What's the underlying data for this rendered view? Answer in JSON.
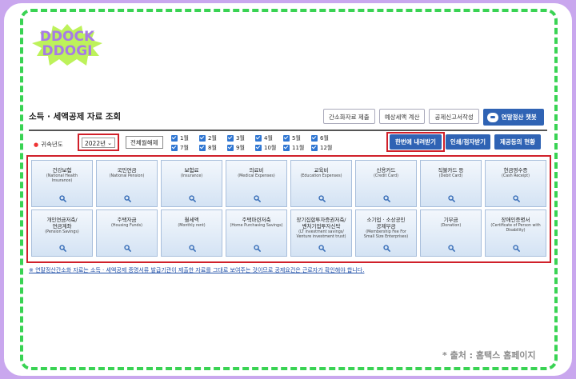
{
  "logo": {
    "line1": "DDOCK",
    "line2": "DDOGI"
  },
  "page_title": "소득 · 세액공제 자료 조회",
  "top_buttons": {
    "simplified": "간소화자료 제출",
    "estimate": "예상세액 계산",
    "deduction_form": "공제신고서작성",
    "chatbot": "연말정산 챗봇"
  },
  "filter": {
    "year_label": "귀속년도",
    "year_value": "2022년",
    "all_month_button": "전체월해제",
    "months": [
      "1월",
      "2월",
      "3월",
      "4월",
      "5월",
      "6월",
      "7월",
      "8월",
      "9월",
      "10월",
      "11월",
      "12월"
    ],
    "download_all": "한번에 내려받기",
    "print_view": "인쇄/점자받기",
    "provision_status": "제공등의 현황"
  },
  "tiles": [
    {
      "ko": "건강보험",
      "en": "(National Health\nInsurance)"
    },
    {
      "ko": "국민연금",
      "en": "(National Pension)"
    },
    {
      "ko": "보험료",
      "en": "(Insurance)"
    },
    {
      "ko": "의료비",
      "en": "(Medical Expenses)"
    },
    {
      "ko": "교육비",
      "en": "(Education Expenses)"
    },
    {
      "ko": "신용카드",
      "en": "(Credit Card)"
    },
    {
      "ko": "직불카드 등",
      "en": "(Debit Card)"
    },
    {
      "ko": "현금영수증",
      "en": "(Cash Receipt)"
    },
    {
      "ko": "개인연금저축/\n연금계좌",
      "en": "(Pension Savings)"
    },
    {
      "ko": "주택자금",
      "en": "(Housing Funds)"
    },
    {
      "ko": "월세액",
      "en": "(Monthly rent)"
    },
    {
      "ko": "주택마련저축",
      "en": "(Home Purchasing Savings)"
    },
    {
      "ko": "장기집합투자증권저축/\n벤처기업투자신탁",
      "en": "(LT investment savings/\nVenture investment trust)"
    },
    {
      "ko": "소기업 · 소상공인\n공제부금",
      "en": "(Membership Fee For\nSmall Size Enterprises)"
    },
    {
      "ko": "기부금",
      "en": "(Donation)"
    },
    {
      "ko": "장애인증명서",
      "en": "(Certificate of Person with\nDisability)"
    }
  ],
  "notice": "※ 연말정산간소화 자료는 소득 · 세액공제 증명서류 발급기관이 제출한 자료를 그대로 보여주는 것이므로 공제요건은 근로자가 확인해야 합니다.",
  "source": "* 출처 : 홈택스 홈페이지",
  "colors": {
    "accent": "#2f63b4",
    "highlight": "#d0202a",
    "border_dash": "#39d353",
    "background": "#c9a7ee"
  }
}
